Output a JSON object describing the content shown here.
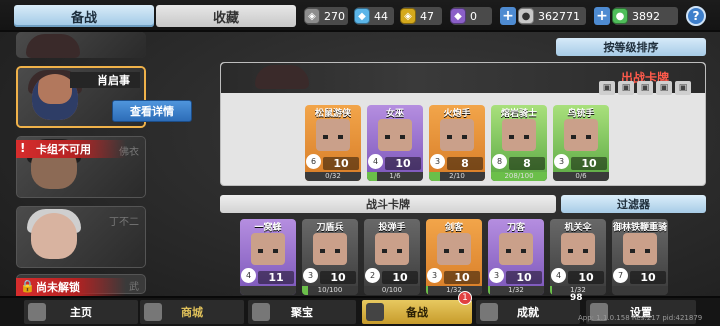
{
  "header": {
    "tabs": [
      {
        "label": "备战"
      },
      {
        "label": "收藏"
      }
    ],
    "resources": [
      {
        "icon": "silver-coin-icon",
        "value": "270",
        "color": "#8d8d8d"
      },
      {
        "icon": "crystal-icon",
        "value": "44",
        "color": "#5bb5e8"
      },
      {
        "icon": "gold-badge-icon",
        "value": "47",
        "color": "#d5a91c"
      },
      {
        "icon": "purple-gem-icon",
        "value": "0",
        "color": "#8b5fc8"
      },
      {
        "icon": "coin-icon",
        "value": "362771",
        "color": "#c9c9c9"
      },
      {
        "icon": "green-gem-icon",
        "value": "3892",
        "color": "#4fbe5a"
      }
    ],
    "help_label": "?"
  },
  "left_panel": {
    "selected_hero_name": "肖启事",
    "detail_button": "查看详情",
    "deck_unusable": "卡组不可用",
    "hero3_name": "佛衣",
    "hero4_name": "丁不二",
    "locked_label": "尚未解锁",
    "hero5_name": "武"
  },
  "sort_button": "按等级排序",
  "battle": {
    "title": "出战卡牌",
    "cards": [
      {
        "name": "松鼠游侠",
        "level": "10",
        "cost": "6",
        "progress": "0/32",
        "progress_frac": 0.0,
        "rarity": "orange"
      },
      {
        "name": "女巫",
        "level": "10",
        "cost": "4",
        "progress": "1/6",
        "progress_frac": 0.17,
        "rarity": "purple"
      },
      {
        "name": "火炮手",
        "level": "8",
        "cost": "3",
        "progress": "2/10",
        "progress_frac": 0.2,
        "rarity": "orange"
      },
      {
        "name": "熔岩骑士",
        "level": "8",
        "cost": "8",
        "progress": "208/100",
        "progress_frac": 1.0,
        "rarity": "green"
      },
      {
        "name": "鸟铳手",
        "level": "10",
        "cost": "3",
        "progress": "0/6",
        "progress_frac": 0.0,
        "rarity": "green"
      }
    ]
  },
  "fight_cards_label": "战斗卡牌",
  "filter_label": "过滤器",
  "fight": {
    "cards": [
      {
        "name": "一窝蜂",
        "level": "11",
        "cost": "4",
        "progress": "",
        "progress_frac": 0.0,
        "rarity": "purple"
      },
      {
        "name": "刀盾兵",
        "level": "10",
        "cost": "3",
        "progress": "10/100",
        "progress_frac": 0.1,
        "rarity": "dark"
      },
      {
        "name": "投弹手",
        "level": "10",
        "cost": "2",
        "progress": "0/100",
        "progress_frac": 0.0,
        "rarity": "dark"
      },
      {
        "name": "剑客",
        "level": "10",
        "cost": "3",
        "progress": "1/32",
        "progress_frac": 0.03,
        "rarity": "orange"
      },
      {
        "name": "刀客",
        "level": "10",
        "cost": "3",
        "progress": "1/32",
        "progress_frac": 0.03,
        "rarity": "purple"
      },
      {
        "name": "机关伞",
        "level": "10",
        "cost": "4",
        "progress": "1/32",
        "progress_frac": 0.03,
        "rarity": "dark"
      },
      {
        "name": "御林铁鞭重骑兵",
        "level": "10",
        "cost": "7",
        "progress": "",
        "progress_frac": 0.0,
        "rarity": "dark"
      }
    ]
  },
  "bottom_nav": [
    {
      "label": "主页",
      "icon": "home-icon"
    },
    {
      "label": "商城",
      "icon": "shop-icon"
    },
    {
      "label": "聚宝",
      "icon": "treasure-icon"
    },
    {
      "label": "备战",
      "icon": "cards-icon",
      "badge": "1"
    },
    {
      "label": "成就",
      "icon": "achievement-icon",
      "badge": "98"
    },
    {
      "label": "设置",
      "icon": "gear-icon"
    }
  ],
  "version_text": "App: 1.1.0.158 Res:217 pid:421879"
}
